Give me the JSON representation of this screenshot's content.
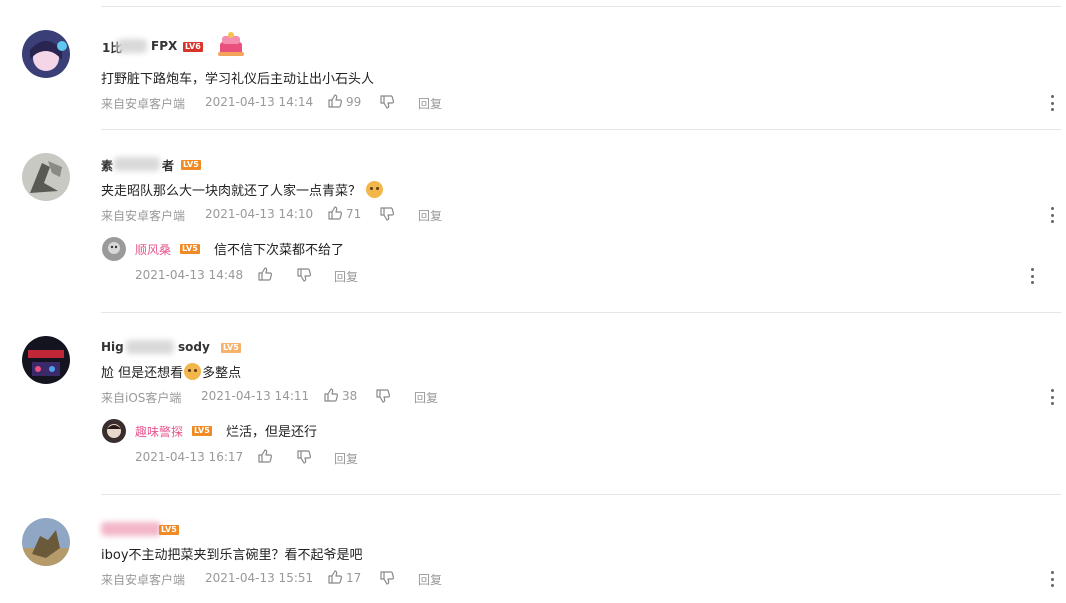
{
  "colors": {
    "accent_pink": "#e8578f",
    "meta_gray": "#999999",
    "divider": "#e6e6e6",
    "level_red": "#d9342b",
    "level_orange": "#f08a24"
  },
  "comments": [
    {
      "username": "1比",
      "username_tail": "FPX",
      "level": "LV6",
      "content": "打野脏下路炮车，学习礼仪后主动让出小石头人",
      "source": "来自安卓客户端",
      "time": "2021-04-13 14:14",
      "likes": "99",
      "reply_label": "回复"
    },
    {
      "username": "素",
      "username_tail": "者",
      "level": "LV5",
      "content": "夹走昭队那么大一块肉就还了人家一点青菜？",
      "source": "来自安卓客户端",
      "time": "2021-04-13 14:10",
      "likes": "71",
      "reply_label": "回复",
      "reply": {
        "username": "顺风桑",
        "level": "LV5",
        "content": "信不信下次菜都不给了",
        "time": "2021-04-13 14:48",
        "reply_label": "回复"
      }
    },
    {
      "username": "Hig",
      "username_tail": "sody",
      "level": "LV5",
      "content_before": "尬 但是还想看",
      "content_after": "多整点",
      "source": "来自iOS客户端",
      "time": "2021-04-13 14:11",
      "likes": "38",
      "reply_label": "回复",
      "reply": {
        "username": "趣味警探",
        "level": "LV5",
        "content": "烂活，但是还行",
        "time": "2021-04-13 16:17",
        "reply_label": "回复"
      }
    },
    {
      "username": "",
      "username_tail": "",
      "level": "LV5",
      "content": "iboy不主动把菜夹到乐言碗里？看不起爷是吧",
      "source": "来自安卓客户端",
      "time": "2021-04-13 15:51",
      "likes": "17",
      "reply_label": "回复"
    }
  ]
}
